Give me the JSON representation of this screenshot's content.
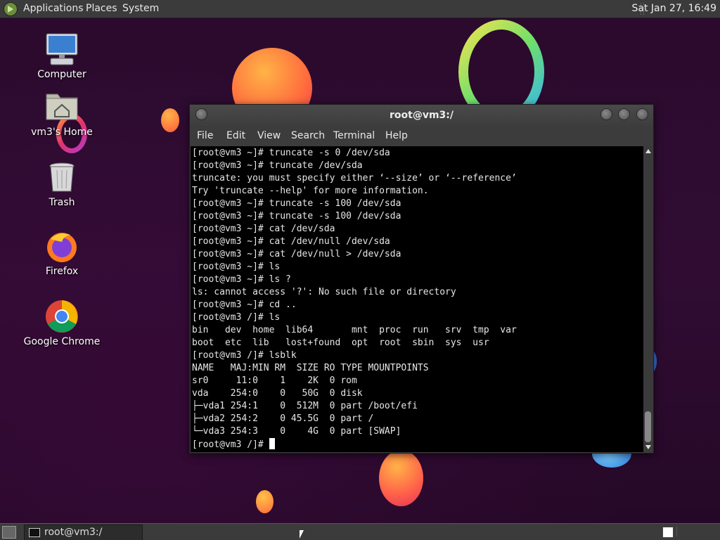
{
  "top_panel": {
    "menus": [
      "Applications",
      "Places",
      "System"
    ],
    "clock": "Sat Jan 27, 16:49"
  },
  "desktop_icons": [
    {
      "label": "Computer",
      "icon": "computer-icon"
    },
    {
      "label": "vm3's Home",
      "icon": "home-folder-icon"
    },
    {
      "label": "Trash",
      "icon": "trash-icon"
    },
    {
      "label": "Firefox",
      "icon": "firefox-icon"
    },
    {
      "label": "Google Chrome",
      "icon": "chrome-icon"
    }
  ],
  "terminal": {
    "title": "root@vm3:/",
    "menu": [
      "File",
      "Edit",
      "View",
      "Search",
      "Terminal",
      "Help"
    ],
    "lines": [
      "[root@vm3 ~]# truncate -s 0 /dev/sda",
      "[root@vm3 ~]# truncate /dev/sda",
      "truncate: you must specify either ‘--size’ or ‘--reference’",
      "Try 'truncate --help' for more information.",
      "[root@vm3 ~]# truncate -s 100 /dev/sda",
      "[root@vm3 ~]# truncate -s 100 /dev/sda",
      "[root@vm3 ~]# cat /dev/sda",
      "[root@vm3 ~]# cat /dev/null /dev/sda",
      "[root@vm3 ~]# cat /dev/null > /dev/sda",
      "[root@vm3 ~]# ls",
      "[root@vm3 ~]# ls ?",
      "ls: cannot access '?': No such file or directory",
      "[root@vm3 ~]# cd ..",
      "[root@vm3 /]# ls",
      "bin   dev  home  lib64       mnt  proc  run   srv  tmp  var",
      "boot  etc  lib   lost+found  opt  root  sbin  sys  usr",
      "[root@vm3 /]# lsblk",
      "NAME   MAJ:MIN RM  SIZE RO TYPE MOUNTPOINTS",
      "sr0     11:0    1    2K  0 rom",
      "vda    254:0    0   50G  0 disk",
      "├─vda1 254:1    0  512M  0 part /boot/efi",
      "├─vda2 254:2    0 45.5G  0 part /",
      "└─vda3 254:3    0    4G  0 part [SWAP]"
    ],
    "prompt": "[root@vm3 /]# "
  },
  "taskbar": {
    "items": [
      {
        "label": "root@vm3:/"
      }
    ]
  }
}
